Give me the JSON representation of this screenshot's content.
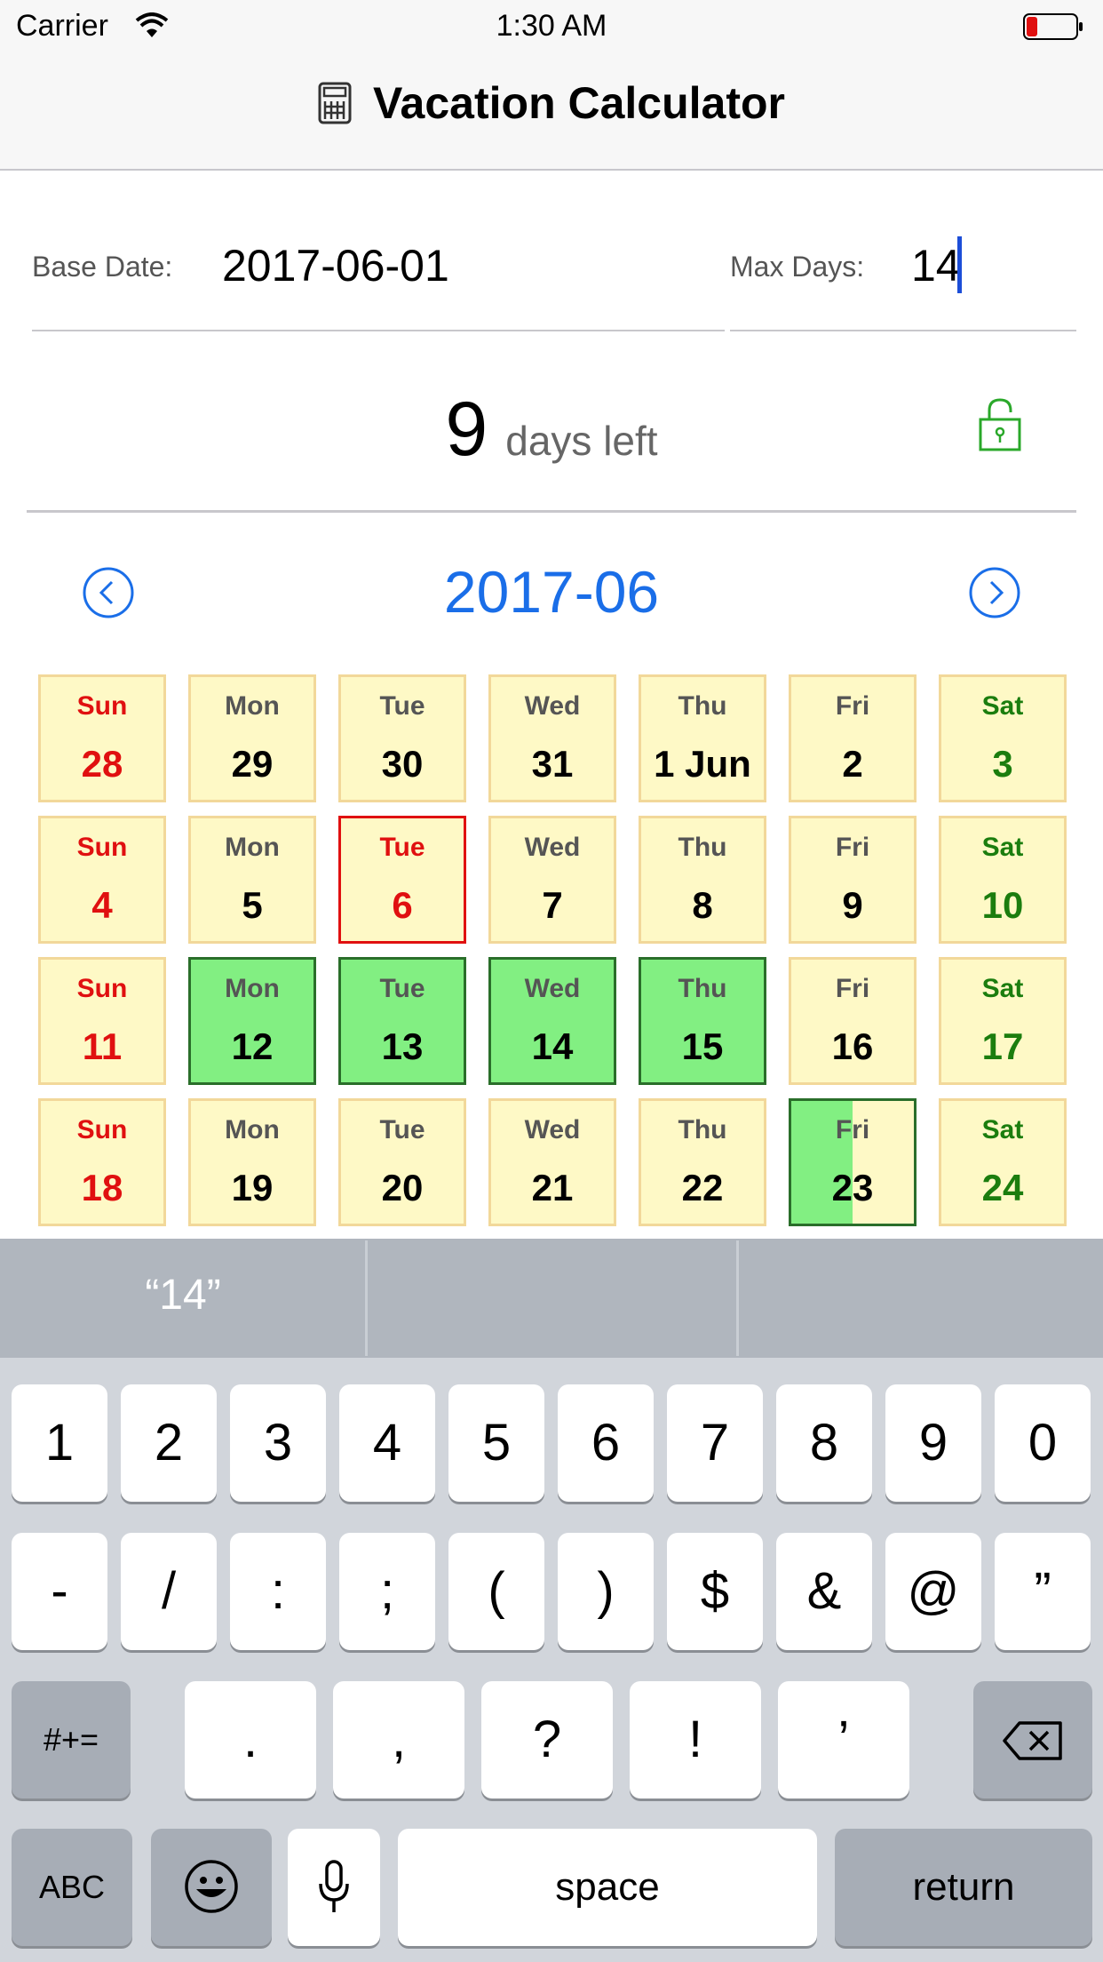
{
  "status_bar": {
    "carrier": "Carrier",
    "time": "1:30 AM"
  },
  "nav": {
    "title": "Vacation Calculator"
  },
  "form": {
    "base_date_label": "Base Date:",
    "base_date_value": "2017-06-01",
    "max_days_label": "Max Days:",
    "max_days_value": "14"
  },
  "summary": {
    "days_left": "9",
    "days_left_text": "days left"
  },
  "calendar": {
    "month_title": "2017-06",
    "weeks": [
      [
        {
          "day": "Sun",
          "date": "28",
          "state": "weekend-sun"
        },
        {
          "day": "Mon",
          "date": "29",
          "state": "normal"
        },
        {
          "day": "Tue",
          "date": "30",
          "state": "normal"
        },
        {
          "day": "Wed",
          "date": "31",
          "state": "normal"
        },
        {
          "day": "Thu",
          "date": "1 Jun",
          "state": "normal"
        },
        {
          "day": "Fri",
          "date": "2",
          "state": "normal"
        },
        {
          "day": "Sat",
          "date": "3",
          "state": "weekend-sat"
        }
      ],
      [
        {
          "day": "Sun",
          "date": "4",
          "state": "weekend-sun"
        },
        {
          "day": "Mon",
          "date": "5",
          "state": "normal"
        },
        {
          "day": "Tue",
          "date": "6",
          "state": "today"
        },
        {
          "day": "Wed",
          "date": "7",
          "state": "normal"
        },
        {
          "day": "Thu",
          "date": "8",
          "state": "normal"
        },
        {
          "day": "Fri",
          "date": "9",
          "state": "normal"
        },
        {
          "day": "Sat",
          "date": "10",
          "state": "weekend-sat"
        }
      ],
      [
        {
          "day": "Sun",
          "date": "11",
          "state": "weekend-sun"
        },
        {
          "day": "Mon",
          "date": "12",
          "state": "vacation"
        },
        {
          "day": "Tue",
          "date": "13",
          "state": "vacation"
        },
        {
          "day": "Wed",
          "date": "14",
          "state": "vacation"
        },
        {
          "day": "Thu",
          "date": "15",
          "state": "vacation"
        },
        {
          "day": "Fri",
          "date": "16",
          "state": "normal"
        },
        {
          "day": "Sat",
          "date": "17",
          "state": "weekend-sat"
        }
      ],
      [
        {
          "day": "Sun",
          "date": "18",
          "state": "weekend-sun"
        },
        {
          "day": "Mon",
          "date": "19",
          "state": "normal"
        },
        {
          "day": "Tue",
          "date": "20",
          "state": "normal"
        },
        {
          "day": "Wed",
          "date": "21",
          "state": "normal"
        },
        {
          "day": "Thu",
          "date": "22",
          "state": "normal"
        },
        {
          "day": "Fri",
          "date": "23",
          "state": "half-vacation"
        },
        {
          "day": "Sat",
          "date": "24",
          "state": "weekend-sat"
        }
      ]
    ]
  },
  "keyboard": {
    "suggestion": "“14”",
    "row1": [
      "1",
      "2",
      "3",
      "4",
      "5",
      "6",
      "7",
      "8",
      "9",
      "0"
    ],
    "row2": [
      "-",
      "/",
      ":",
      ";",
      "(",
      ")",
      "$",
      "&",
      "@",
      "”"
    ],
    "row3": [
      ".",
      ",",
      "?",
      "!",
      "’"
    ],
    "shift_label": "#+=",
    "abc_label": "ABC",
    "space_label": "space",
    "return_label": "return",
    "icons": {
      "emoji": "emoji-icon",
      "mic": "microphone-icon",
      "delete": "backspace-icon"
    }
  },
  "colors": {
    "accent": "#1a6ee8",
    "vacation": "#82ef82",
    "cell": "#fef9c6",
    "sunday": "#e01010",
    "saturday": "#1b7d0e"
  }
}
